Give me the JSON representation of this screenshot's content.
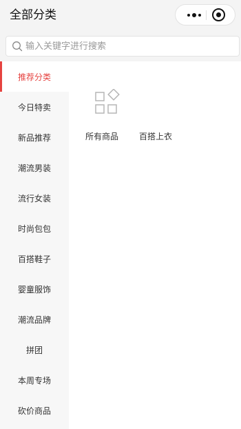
{
  "navbar": {
    "title": "全部分类",
    "more_icon": "more-dots-icon",
    "close_icon": "circle-close-icon"
  },
  "search": {
    "placeholder": "输入关键字进行搜索",
    "value": "",
    "icon": "search-icon"
  },
  "sidebar": {
    "items": [
      {
        "label": "推荐分类",
        "active": true
      },
      {
        "label": "今日特卖",
        "active": false
      },
      {
        "label": "新品推荐",
        "active": false
      },
      {
        "label": "潮流男装",
        "active": false
      },
      {
        "label": "流行女装",
        "active": false
      },
      {
        "label": "时尚包包",
        "active": false
      },
      {
        "label": "百搭鞋子",
        "active": false
      },
      {
        "label": "婴童服饰",
        "active": false
      },
      {
        "label": "潮流品牌",
        "active": false
      },
      {
        "label": "拼团",
        "active": false
      },
      {
        "label": "本周专场",
        "active": false
      },
      {
        "label": "砍价商品",
        "active": false
      }
    ]
  },
  "content": {
    "categories": [
      {
        "label": "所有商品",
        "icon": "grid-categories-icon"
      },
      {
        "label": "百搭上衣",
        "icon": ""
      }
    ]
  },
  "colors": {
    "accent": "#e64340",
    "sidebar_bg": "#f7f7f7",
    "navbar_bg": "#f4f4f4"
  }
}
